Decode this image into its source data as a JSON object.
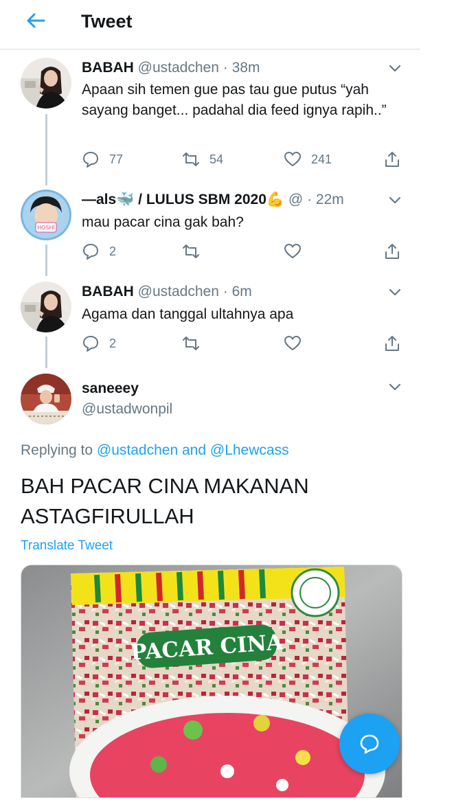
{
  "header": {
    "title": "Tweet"
  },
  "tweets": [
    {
      "name": "BABAH",
      "handle": "@ustadchen",
      "time": "38m",
      "text": "Apaan sih temen gue pas tau gue putus “yah sayang banget... padahal dia feed ignya rapih..”",
      "replies": "77",
      "retweets": "54",
      "likes": "241"
    },
    {
      "name": "—als🐳 / LULUS SBM 2020💪",
      "handle": "@",
      "time": "22m",
      "text": "mau pacar cina gak bah?",
      "replies": "2",
      "retweets": "",
      "likes": ""
    },
    {
      "name": "BABAH",
      "handle": "@ustadchen",
      "time": "6m",
      "text": "Agama dan tanggal ultahnya apa",
      "replies": "2",
      "retweets": "",
      "likes": ""
    }
  ],
  "main_tweet": {
    "name": "saneeey",
    "handle": "@ustadwonpil",
    "replying_prefix": "Replying to",
    "replying_user1": "@ustadchen",
    "replying_and": "and",
    "replying_user2": "@Lhewcass",
    "text": "BAH PACAR CINA MAKANAN ASTAGFIRULLAH",
    "translate": "Translate Tweet",
    "media_label": "PACAR CINA"
  },
  "colors": {
    "accent": "#1da1f2",
    "secondary_text": "#657786",
    "thread_line": "#c4cfd6"
  },
  "icons": [
    "back-arrow-icon",
    "chevron-down-icon",
    "reply-icon",
    "retweet-icon",
    "like-icon",
    "share-icon",
    "compose-icon"
  ]
}
